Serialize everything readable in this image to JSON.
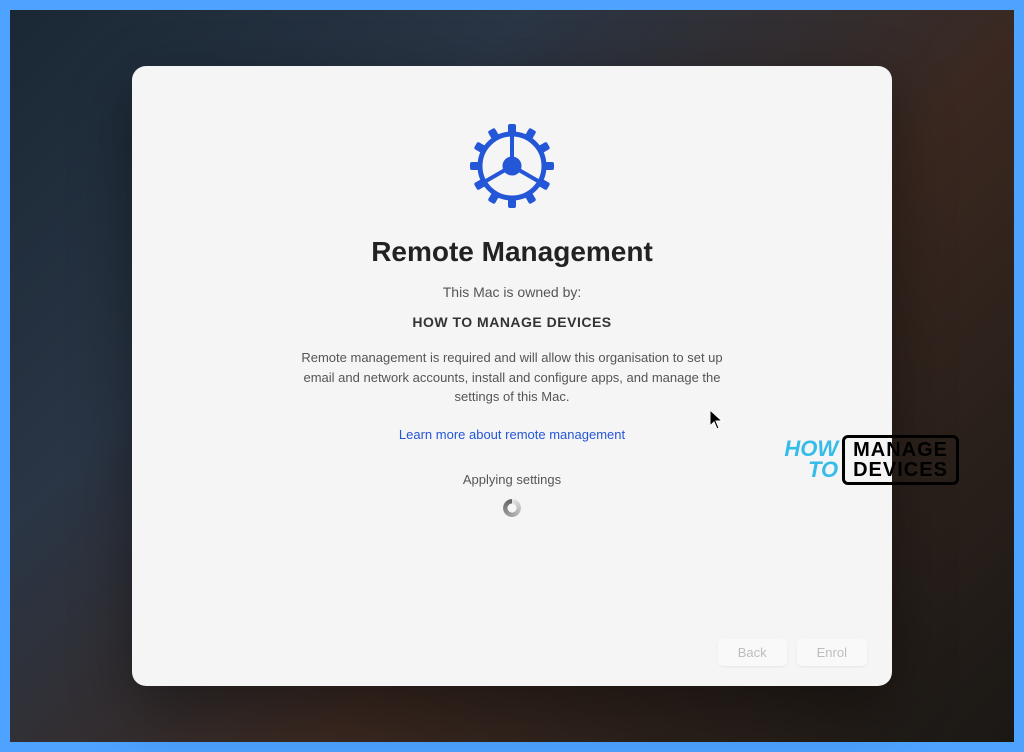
{
  "dialog": {
    "title": "Remote Management",
    "owned_by_label": "This Mac is owned by:",
    "owner_name": "HOW TO MANAGE DEVICES",
    "description": "Remote management is required and will allow this organisation to set up email and network accounts, install and configure apps, and manage the settings of this Mac.",
    "learn_more_label": "Learn more about remote management",
    "status_text": "Applying settings",
    "buttons": {
      "back": "Back",
      "enrol": "Enrol"
    }
  },
  "watermark": {
    "how": "HOW",
    "to": "TO",
    "manage": "MANAGE",
    "devices": "DEVICES"
  },
  "colors": {
    "accent_blue": "#2456d8",
    "gear_blue": "#2456d8",
    "frame_blue": "#4da3ff",
    "watermark_cyan": "#35bce8"
  }
}
